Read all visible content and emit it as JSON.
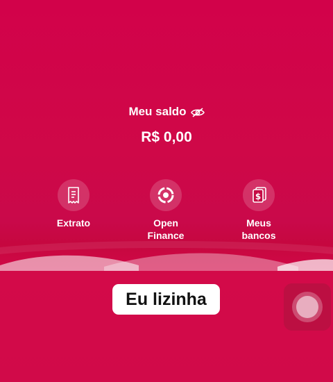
{
  "balance": {
    "title": "Meu saldo",
    "value": "R$ 0,00",
    "visibility_icon": "eye-slash-icon"
  },
  "actions": [
    {
      "label": "Extrato",
      "icon": "receipt-icon"
    },
    {
      "label": "Open\nFinance",
      "icon": "open-finance-icon"
    },
    {
      "label": "Meus\nbancos",
      "icon": "banks-icon"
    }
  ],
  "caption": "Eu lizinha",
  "assistive_touch": {
    "icon": "assistive-touch-icon"
  },
  "colors": {
    "background": "#d00a47",
    "text": "#ffffff",
    "caption_bg": "#ffffff"
  }
}
